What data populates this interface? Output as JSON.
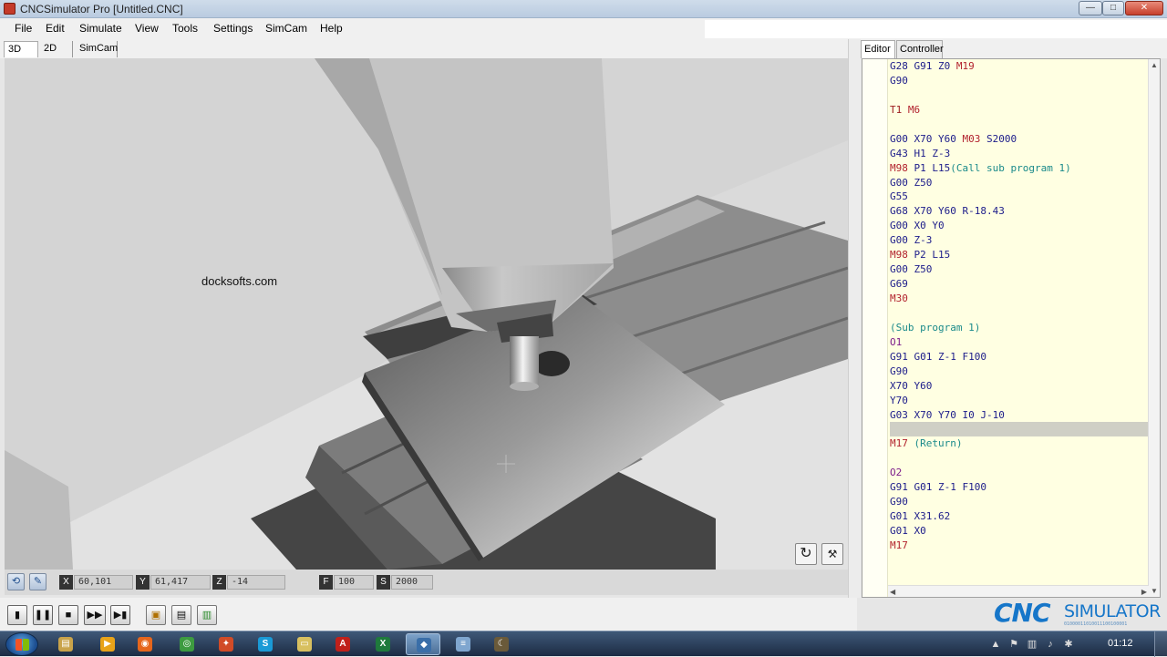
{
  "window": {
    "title": "CNCSimulator Pro [Untitled.CNC]",
    "minimize_glyph": "—",
    "maximize_glyph": "□",
    "close_glyph": "✕"
  },
  "menu": {
    "items": [
      "File",
      "Edit",
      "Simulate",
      "View",
      "Tools",
      "Settings",
      "SimCam",
      "Help"
    ]
  },
  "view_tabs": [
    "3D",
    "2D",
    "SimCam"
  ],
  "viewport": {
    "watermark": "docksofts.com",
    "reset_view_icon": "rotate-icon",
    "coolant_icon": "tap-icon"
  },
  "statusbar": {
    "coords": [
      {
        "label": "X",
        "value": "60,101"
      },
      {
        "label": "Y",
        "value": "61,417"
      },
      {
        "label": "Z",
        "value": "-14"
      },
      {
        "label": "F",
        "value": "100"
      },
      {
        "label": "S",
        "value": "2000"
      }
    ]
  },
  "controls": {
    "buttons": [
      {
        "name": "step-button",
        "glyph": "▮"
      },
      {
        "name": "pause-button",
        "glyph": "❚❚"
      },
      {
        "name": "stop-button",
        "glyph": "■"
      },
      {
        "name": "fast-forward-button",
        "glyph": "▶▶"
      },
      {
        "name": "play-to-end-button",
        "glyph": "▶▮"
      },
      {
        "name": "tool-1-button",
        "glyph": "▣"
      },
      {
        "name": "tool-2-button",
        "glyph": "▤"
      },
      {
        "name": "tool-3-button",
        "glyph": "▥"
      }
    ]
  },
  "editor_tabs": [
    "Editor",
    "Controller"
  ],
  "editor": {
    "highlighted_line": 25,
    "lines": [
      [
        [
          "g",
          "G28 G91 Z0 "
        ],
        [
          "m",
          "M19"
        ]
      ],
      [
        [
          "g",
          "G90"
        ]
      ],
      [],
      [
        [
          "t",
          "T1 "
        ],
        [
          "m",
          "M6"
        ]
      ],
      [],
      [
        [
          "g",
          "G00 X70 Y60 "
        ],
        [
          "m",
          "M03"
        ],
        [
          "g",
          " S2000"
        ]
      ],
      [
        [
          "g",
          "G43 H1 Z-3"
        ]
      ],
      [
        [
          "m",
          "M98"
        ],
        [
          "g",
          " P1 L15"
        ],
        [
          "c",
          "(Call sub program 1)"
        ]
      ],
      [
        [
          "g",
          "G00 Z50"
        ]
      ],
      [
        [
          "g",
          "G55"
        ]
      ],
      [
        [
          "g",
          "G68 X70 Y60 R-18.43"
        ]
      ],
      [
        [
          "g",
          "G00 X0 Y0"
        ]
      ],
      [
        [
          "g",
          "G00 Z-3"
        ]
      ],
      [
        [
          "m",
          "M98"
        ],
        [
          "g",
          " P2 L15"
        ]
      ],
      [
        [
          "g",
          "G00 Z50"
        ]
      ],
      [
        [
          "g",
          "G69"
        ]
      ],
      [
        [
          "m",
          "M30"
        ]
      ],
      [],
      [
        [
          "c",
          "(Sub program 1)"
        ]
      ],
      [
        [
          "o",
          "O1"
        ]
      ],
      [
        [
          "g",
          "G91 G01 Z-1 F100"
        ]
      ],
      [
        [
          "g",
          "G90"
        ]
      ],
      [
        [
          "g",
          "X70 Y60"
        ]
      ],
      [
        [
          "g",
          "Y70"
        ]
      ],
      [
        [
          "g",
          "G03 X70 Y70 I0 J-10"
        ]
      ],
      [],
      [
        [
          "m",
          "M17"
        ],
        [
          "c",
          " (Return)"
        ]
      ],
      [],
      [
        [
          "o",
          "O2"
        ]
      ],
      [
        [
          "g",
          "G91 G01 Z-1 F100"
        ]
      ],
      [
        [
          "g",
          "G90"
        ]
      ],
      [
        [
          "g",
          "G01 X31.62"
        ]
      ],
      [
        [
          "g",
          "G01 X0"
        ]
      ],
      [
        [
          "m",
          "M17"
        ]
      ]
    ]
  },
  "brand": {
    "cnc": "CNC",
    "simulator": "SIMULATOR",
    "binary": "01000011010011100100001"
  },
  "taskbar": {
    "apps": [
      {
        "name": "explorer-taskbar-icon",
        "color": "#c9a34a",
        "glyph": "▤"
      },
      {
        "name": "media-player-taskbar-icon",
        "color": "#e8a319",
        "glyph": "▶"
      },
      {
        "name": "firefox-taskbar-icon",
        "color": "#e6661c",
        "glyph": "◉"
      },
      {
        "name": "chrome-taskbar-icon",
        "color": "#3d9b40",
        "glyph": "◎"
      },
      {
        "name": "app-taskbar-icon",
        "color": "#d14b27",
        "glyph": "✦"
      },
      {
        "name": "skype-taskbar-icon",
        "color": "#1a9ad6",
        "glyph": "S"
      },
      {
        "name": "folder-taskbar-icon",
        "color": "#d8c060",
        "glyph": "▭"
      },
      {
        "name": "acrobat-taskbar-icon",
        "color": "#c0201a",
        "glyph": "A"
      },
      {
        "name": "excel-taskbar-icon",
        "color": "#1f7a3c",
        "glyph": "X"
      },
      {
        "name": "cncsimulator-taskbar-icon",
        "color": "#3a6ea8",
        "glyph": "◆"
      },
      {
        "name": "notepad-taskbar-icon",
        "color": "#7fa6cf",
        "glyph": "≡"
      },
      {
        "name": "unknown-taskbar-icon",
        "color": "#6a5a3a",
        "glyph": "☾"
      }
    ],
    "clock": "01:12"
  }
}
